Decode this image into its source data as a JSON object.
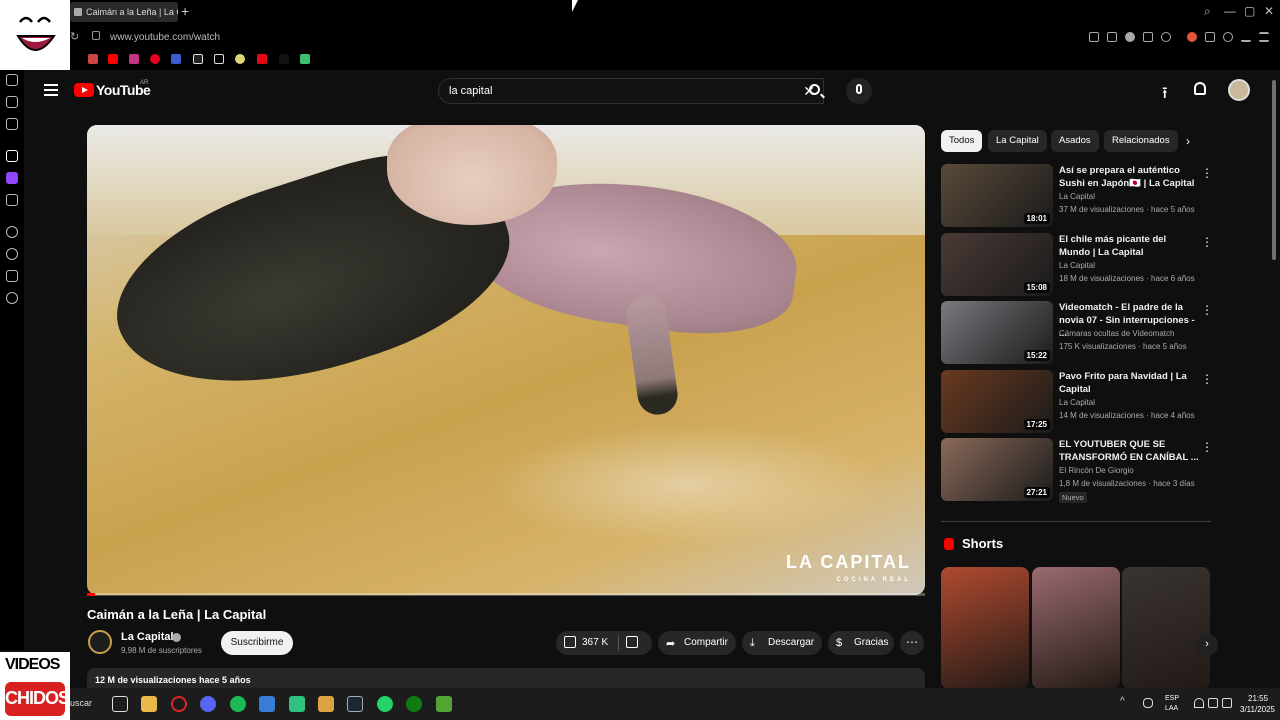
{
  "browser": {
    "tab_title": "Caimán a la Leña | La Capital",
    "url": "www.youtube.com/watch"
  },
  "overlays": {
    "logo_bottom_top": "VIDEOS",
    "logo_bottom_bottom": "CHIDOS"
  },
  "header": {
    "logo_text": "YouTube",
    "country_code": "AR",
    "search_value": "la capital",
    "clear_glyph": "✕",
    "upload_glyph": "⭱"
  },
  "video": {
    "watermark_brand": "LA CAPITAL",
    "watermark_sub": "COCINA REAL",
    "progress_fraction": 0.01,
    "title": "Caimán a la Leña | La Capital",
    "channel_name": "La Capital",
    "subscribers": "9,98 M de suscriptores",
    "subscribe_label": "Suscribirme",
    "likes": "367 K",
    "share_label": "Compartir",
    "download_label": "Descargar",
    "thanks_label": "Gracias",
    "more_glyph": "⋯",
    "description_stats": "12 M de visualizaciones  hace 5 años"
  },
  "chips": {
    "items": [
      "Todos",
      "La Capital",
      "Asados",
      "Relacionados"
    ],
    "next_glyph": "›"
  },
  "recommendations": [
    {
      "title": "Así se prepara el auténtico Sushi en Japón🇯🇵 | La Capital",
      "channel": "La Capital",
      "meta": "37 M de visualizaciones · hace 5 años",
      "duration": "18:01",
      "badge": "",
      "thumb_color": "#5a4a3a"
    },
    {
      "title": "El chile más picante del Mundo | La Capital",
      "channel": "La Capital",
      "meta": "18 M de visualizaciones · hace 6 años",
      "duration": "15:08",
      "badge": "",
      "thumb_color": "#4a3a36"
    },
    {
      "title": "Videomatch - El padre de la novia 07 - Sin interrupciones - ...",
      "channel": "Cámaras ocultas de Videomatch",
      "meta": "175 K visualizaciones · hace 5 años",
      "duration": "15:22",
      "badge": "",
      "thumb_color": "#7a7a80"
    },
    {
      "title": "Pavo Frito para Navidad | La Capital",
      "channel": "La Capital",
      "meta": "14 M de visualizaciones · hace 4 años",
      "duration": "17:25",
      "badge": "",
      "thumb_color": "#6a3a20"
    },
    {
      "title": "EL YOUTUBER QUE SE TRANSFORMÓ EN CANÍBAL ...",
      "channel": "El Rincón De Giorgio",
      "meta": "1,8 M de visualizaciones · hace 3 días",
      "duration": "27:21",
      "badge": "Nuevo",
      "thumb_color": "#8a6a5a"
    }
  ],
  "recommendation_menu_glyph": "⋮",
  "shorts": {
    "title": "Shorts",
    "next_glyph": "›",
    "thumb_colors": [
      "#b04a30",
      "#9a6a70",
      "#3a3430"
    ]
  },
  "taskbar": {
    "search_label": "uscar",
    "lang_1": "ESP",
    "lang_2": "LAA",
    "time": "21:55",
    "date": "3/11/2025"
  },
  "colors": {
    "accent_red": "#ff0000",
    "background": "#0f0f0f",
    "chip_bg": "#272727"
  }
}
